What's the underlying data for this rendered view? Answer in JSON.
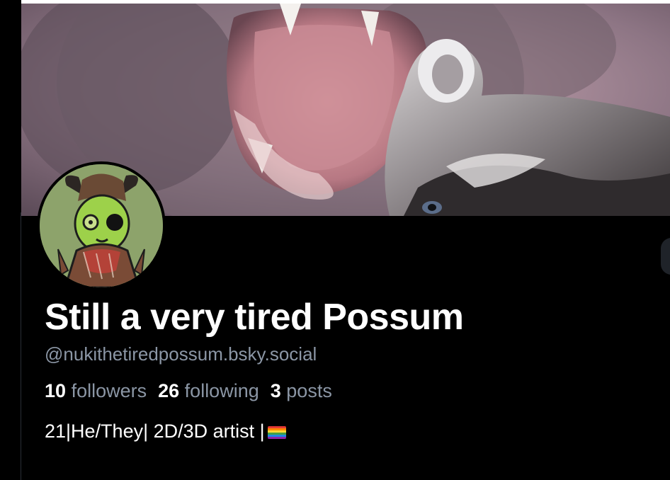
{
  "profile": {
    "display_name": "Still a very tired Possum",
    "handle": "@nukithetiredpossum.bsky.social",
    "stats": {
      "followers_count": "10",
      "followers_label": "followers",
      "following_count": "26",
      "following_label": "following",
      "posts_count": "3",
      "posts_label": "posts"
    },
    "bio": "21|He/They| 2D/3D artist |",
    "bio_emoji": "rainbow-flag-icon"
  },
  "banner": {
    "image": "yawning-cat-and-raccoon-photo"
  },
  "avatar": {
    "image": "green-possum-character-drawing"
  },
  "colors": {
    "background": "#000000",
    "text_primary": "#ffffff",
    "text_secondary": "#8b96a5",
    "avatar_bg": "#8da36b"
  }
}
